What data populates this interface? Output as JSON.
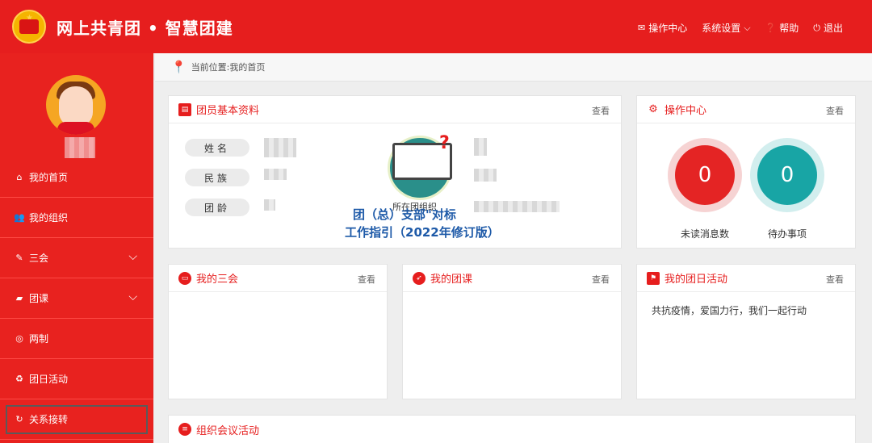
{
  "header": {
    "title": "网上共青团 • 智慧团建",
    "nav": [
      {
        "icon": "envelope-icon",
        "label": "操作中心"
      },
      {
        "icon": "",
        "label": "系统设置"
      },
      {
        "icon": "question-icon",
        "label": "帮助"
      },
      {
        "icon": "power-icon",
        "label": "退出"
      }
    ]
  },
  "sidebar": {
    "items": [
      {
        "icon": "home-icon",
        "label": "我的首页"
      },
      {
        "icon": "users-icon",
        "label": "我的组织"
      },
      {
        "icon": "edit-icon",
        "label": "三会"
      },
      {
        "icon": "folder-icon",
        "label": "团课"
      },
      {
        "icon": "target-icon",
        "label": "两制"
      },
      {
        "icon": "recycle-icon",
        "label": "团日活动"
      },
      {
        "icon": "refresh-icon",
        "label": "关系接转"
      }
    ]
  },
  "breadcrumb": "当前位置:我的首页",
  "panels": {
    "profile": {
      "title": "团员基本资料",
      "more": "查看",
      "fields": [
        "姓名",
        "民族",
        "团龄"
      ]
    },
    "ops": {
      "title": "操作中心",
      "more": "查看",
      "unread_value": "0",
      "unread_label": "未读消息数",
      "todo_value": "0",
      "todo_label": "待办事项"
    },
    "sanhui": {
      "title": "我的三会",
      "more": "查看"
    },
    "tuanke": {
      "title": "我的团课",
      "more": "查看"
    },
    "tuanri": {
      "title": "我的团日活动",
      "more": "查看",
      "item": "共抗疫情，爱国力行，我们一起行动"
    },
    "meeting": {
      "title": "组织会议活动"
    }
  },
  "overlay": {
    "small": "所在团组织",
    "line1": "团（总）支部\"对标",
    "line2": "工作指引（2022年修订版）"
  },
  "colors": {
    "primary": "#e61e1e",
    "teal": "#18a5a5",
    "overlay_text": "#1e5aa8"
  }
}
